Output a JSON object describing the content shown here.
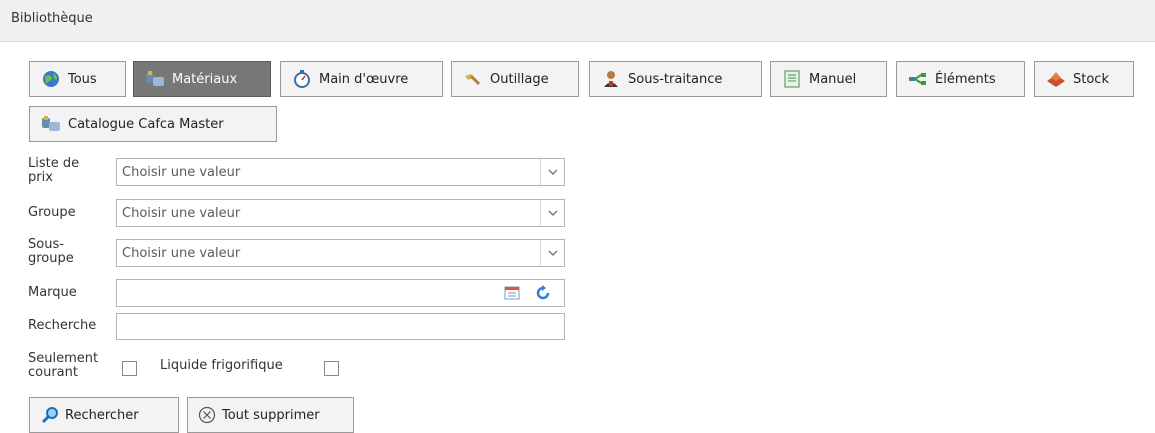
{
  "panel": {
    "title": "Bibliothèque"
  },
  "tabs": [
    {
      "label": "Tous",
      "icon": "globe-icon"
    },
    {
      "label": "Matériaux",
      "icon": "materials-icon",
      "active": true
    },
    {
      "label": "Main d'œuvre",
      "icon": "stopwatch-icon"
    },
    {
      "label": "Outillage",
      "icon": "tools-icon"
    },
    {
      "label": "Sous-traitance",
      "icon": "person-icon"
    },
    {
      "label": "Manuel",
      "icon": "manual-icon"
    },
    {
      "label": "Éléments",
      "icon": "elements-icon"
    },
    {
      "label": "Stock",
      "icon": "stock-icon"
    },
    {
      "label": "Catalogue Cafca Master",
      "icon": "materials-icon"
    }
  ],
  "form": {
    "price_list_label": "Liste de prix",
    "price_list_value": "Choisir une valeur",
    "group_label": "Groupe",
    "group_value": "Choisir une valeur",
    "subgroup_label": "Sous-groupe",
    "subgroup_value": "Choisir une valeur",
    "brand_label": "Marque",
    "brand_value": "",
    "search_label": "Recherche",
    "search_value": "",
    "current_only_label": "Seulement courant",
    "current_only_checked": false,
    "refrigerant_label": "Liquide frigorifique",
    "refrigerant_checked": false
  },
  "actions": {
    "search_label": "Rechercher",
    "clear_label": "Tout supprimer"
  }
}
